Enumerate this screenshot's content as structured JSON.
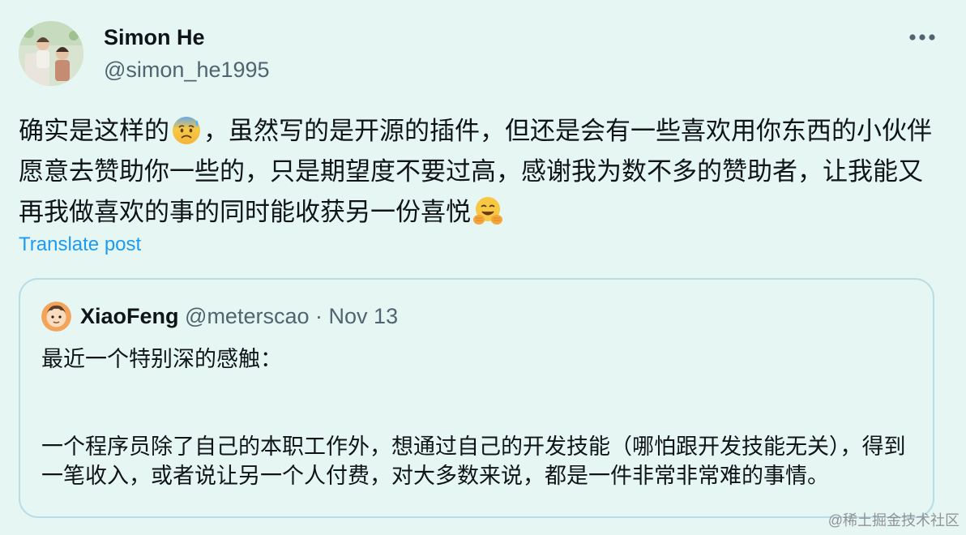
{
  "post": {
    "author": {
      "name": "Simon He",
      "handle": "@simon_he1995"
    },
    "text_part1": "确实是这样的",
    "emoji1": "anxious-sweat-emoji",
    "text_part2": "，虽然写的是开源的插件，但还是会有一些喜欢用你东西的小伙伴愿意去赞助你一些的，只是期望度不要过高，感谢我为数不多的赞助者，让我能又再我做喜欢的事的同时能收获另一份喜悦",
    "emoji2": "hugging-face-emoji",
    "translate_label": "Translate post"
  },
  "quote": {
    "author_name": "XiaoFeng",
    "author_handle": "@meterscao",
    "separator": "·",
    "date": "Nov 13",
    "line1": "最近一个特别深的感触：",
    "line2": "一个程序员除了自己的本职工作外，想通过自己的开发技能（哪怕跟开发技能无关），得到一笔收入，或者说让另一个人付费，对大多数来说，都是一件非常非常难的事情。"
  },
  "watermark": "@稀土掘金技术社区",
  "colors": {
    "background": "#e6f6f3",
    "text": "#0f1419",
    "secondary": "#536471",
    "link": "#1d9bf0",
    "quote_border": "#b9dde6"
  }
}
